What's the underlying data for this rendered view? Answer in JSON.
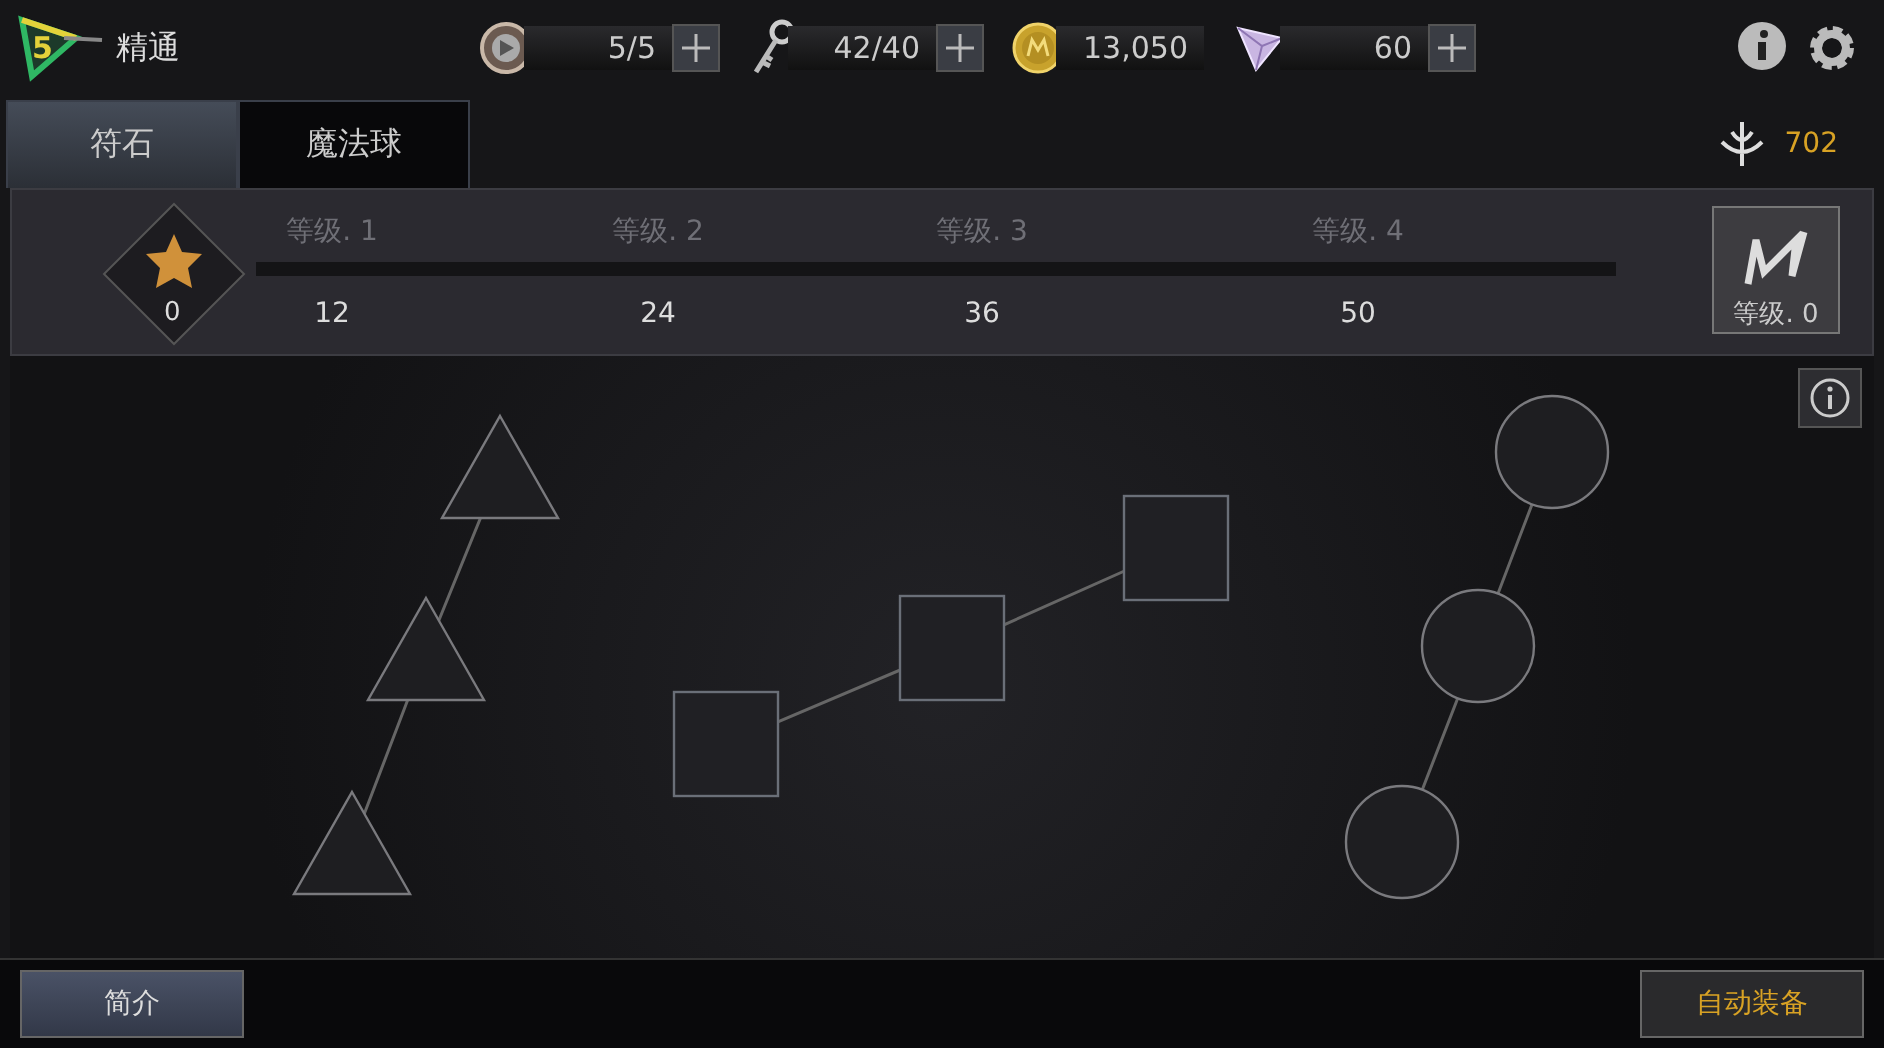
{
  "header": {
    "level_badge": "5",
    "title": "精通"
  },
  "resources": [
    {
      "kind": "medal",
      "value": "5/5",
      "addable": true
    },
    {
      "kind": "key",
      "value": "42/40",
      "addable": true
    },
    {
      "kind": "coin",
      "value": "13,050",
      "addable": false
    },
    {
      "kind": "gem",
      "value": "60",
      "addable": true
    }
  ],
  "tabs": [
    {
      "label": "符石",
      "selected": true
    },
    {
      "label": "魔法球",
      "selected": false
    }
  ],
  "power": "702",
  "progress": {
    "star_count": "0",
    "milestones": [
      {
        "label": "等级. 1",
        "value": "12"
      },
      {
        "label": "等级. 2",
        "value": "24"
      },
      {
        "label": "等级. 3",
        "value": "36"
      },
      {
        "label": "等级. 4",
        "value": "50"
      }
    ],
    "rank": "等级. 0"
  },
  "slot_groups": [
    {
      "kind": "triangle"
    },
    {
      "kind": "square"
    },
    {
      "kind": "circle"
    }
  ],
  "buttons": {
    "intro": "简介",
    "auto_equip": "自动装备"
  }
}
